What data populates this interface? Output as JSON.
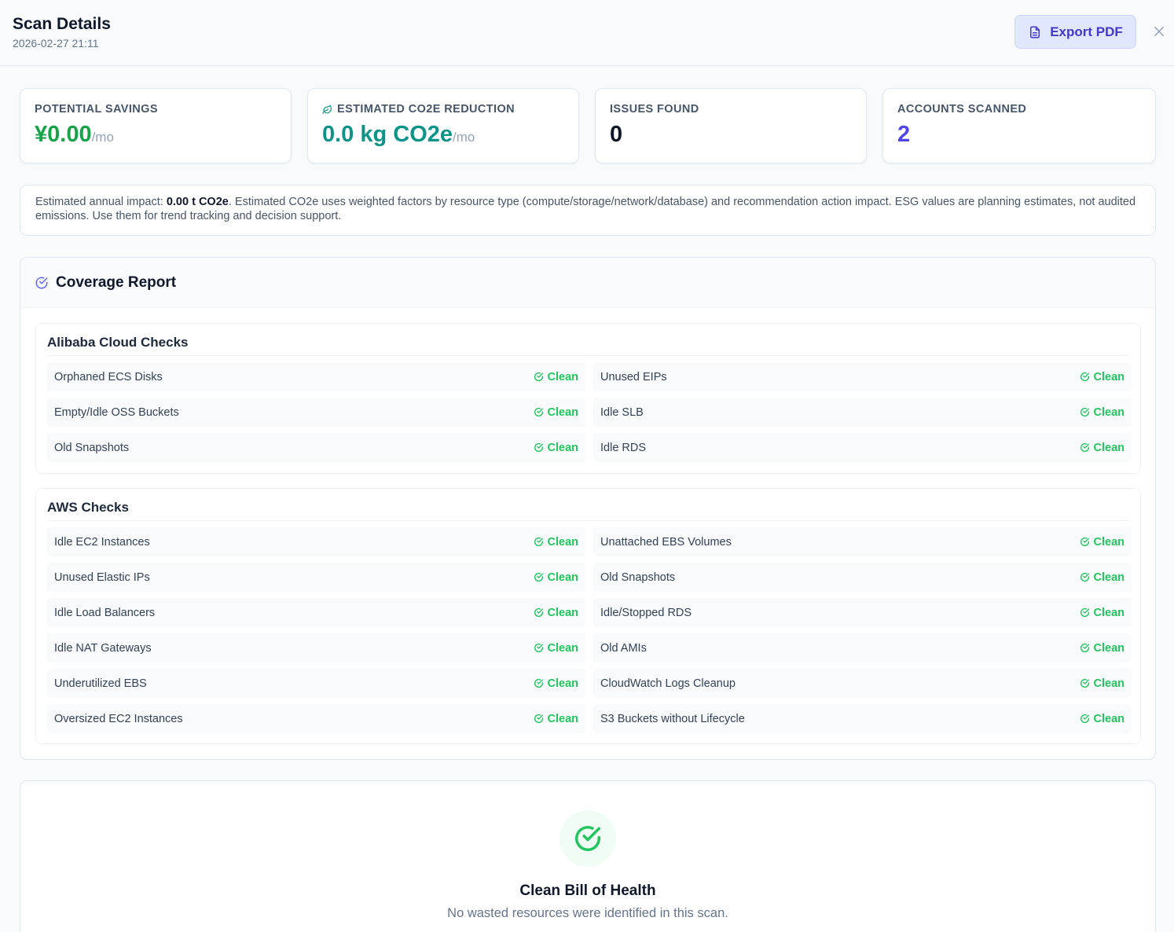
{
  "header": {
    "title": "Scan Details",
    "timestamp": "2026-02-27 21:11",
    "export_label": "Export PDF"
  },
  "stats": [
    {
      "label": "POTENTIAL SAVINGS",
      "value": "¥0.00",
      "unit": "/mo",
      "color": "#16a34a"
    },
    {
      "label": "ESTIMATED CO2E REDUCTION",
      "value": "0.0 kg CO2e",
      "unit": "/mo",
      "color": "#0d9488"
    },
    {
      "label": "ISSUES FOUND",
      "value": "0",
      "unit": "",
      "color": "#0f172a"
    },
    {
      "label": "ACCOUNTS SCANNED",
      "value": "2",
      "unit": "",
      "color": "#4f46e5"
    }
  ],
  "note": {
    "prefix": "Estimated annual impact: ",
    "annual_value": "0.00 t CO2e",
    "body": ". Estimated CO2e uses weighted factors by resource type (compute/storage/network/database) and recommendation action impact. ESG values are planning estimates, not audited emissions. Use them for trend tracking and decision support."
  },
  "coverage": {
    "title": "Coverage Report",
    "sections": [
      {
        "title": "Alibaba Cloud Checks",
        "checks": [
          {
            "name": "Orphaned ECS Disks",
            "status": "Clean"
          },
          {
            "name": "Unused EIPs",
            "status": "Clean"
          },
          {
            "name": "Empty/Idle OSS Buckets",
            "status": "Clean"
          },
          {
            "name": "Idle SLB",
            "status": "Clean"
          },
          {
            "name": "Old Snapshots",
            "status": "Clean"
          },
          {
            "name": "Idle RDS",
            "status": "Clean"
          }
        ]
      },
      {
        "title": "AWS Checks",
        "checks": [
          {
            "name": "Idle EC2 Instances",
            "status": "Clean"
          },
          {
            "name": "Unattached EBS Volumes",
            "status": "Clean"
          },
          {
            "name": "Unused Elastic IPs",
            "status": "Clean"
          },
          {
            "name": "Old Snapshots",
            "status": "Clean"
          },
          {
            "name": "Idle Load Balancers",
            "status": "Clean"
          },
          {
            "name": "Idle/Stopped RDS",
            "status": "Clean"
          },
          {
            "name": "Idle NAT Gateways",
            "status": "Clean"
          },
          {
            "name": "Old AMIs",
            "status": "Clean"
          },
          {
            "name": "Underutilized EBS",
            "status": "Clean"
          },
          {
            "name": "CloudWatch Logs Cleanup",
            "status": "Clean"
          },
          {
            "name": "Oversized EC2 Instances",
            "status": "Clean"
          },
          {
            "name": "S3 Buckets without Lifecycle",
            "status": "Clean"
          }
        ]
      }
    ]
  },
  "health": {
    "title": "Clean Bill of Health",
    "subtitle": "No wasted resources were identified in this scan."
  },
  "colors": {
    "accent": "#4338ca",
    "clean": "#22c55e",
    "savings": "#16a34a",
    "co2": "#0d9488",
    "accounts": "#4f46e5"
  }
}
